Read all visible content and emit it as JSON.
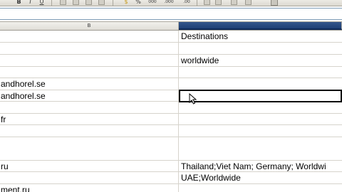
{
  "toolbar": {
    "buttons": [
      {
        "name": "bold-button",
        "label": "B"
      },
      {
        "name": "italic-button",
        "label": "I"
      },
      {
        "name": "underline-button",
        "label": "U"
      },
      {
        "name": "align-left-button",
        "icon": "align-left-icon"
      },
      {
        "name": "align-center-button",
        "icon": "align-center-icon"
      },
      {
        "name": "align-right-button",
        "icon": "align-right-icon"
      },
      {
        "name": "justify-button",
        "icon": "justify-icon"
      },
      {
        "name": "merge-cells-button",
        "icon": "merge-icon"
      },
      {
        "name": "currency-button",
        "label": "$"
      },
      {
        "name": "percent-button",
        "label": "%"
      },
      {
        "name": "thousands-button",
        "label": "000"
      },
      {
        "name": "add-decimal-button",
        "label": ".000"
      },
      {
        "name": "remove-decimal-button",
        "label": ".00"
      }
    ]
  },
  "column_headers": {
    "b": "B",
    "c": ""
  },
  "rows": [
    {
      "b": "",
      "c": "Destinations"
    },
    {
      "b": "",
      "c": ""
    },
    {
      "b": "",
      "c": "worldwide"
    },
    {
      "b": "",
      "c": ""
    },
    {
      "b": "andhorel.se",
      "c": ""
    },
    {
      "b": "andhorel.se",
      "c": ""
    },
    {
      "b": "",
      "c": ""
    },
    {
      "b": "fr",
      "c": ""
    },
    {
      "b": "",
      "c": ""
    },
    {
      "b": "",
      "c": ""
    },
    {
      "b": "ru",
      "c": "Thailand;Viet Nam; Germany; Worldwi"
    },
    {
      "b": "",
      "c": "UAE;Worldwide"
    },
    {
      "b": "ment.ru",
      "c": ""
    }
  ],
  "colors": {
    "selected_column_header": "#1e3f75",
    "gridline": "#d6d3cc"
  }
}
